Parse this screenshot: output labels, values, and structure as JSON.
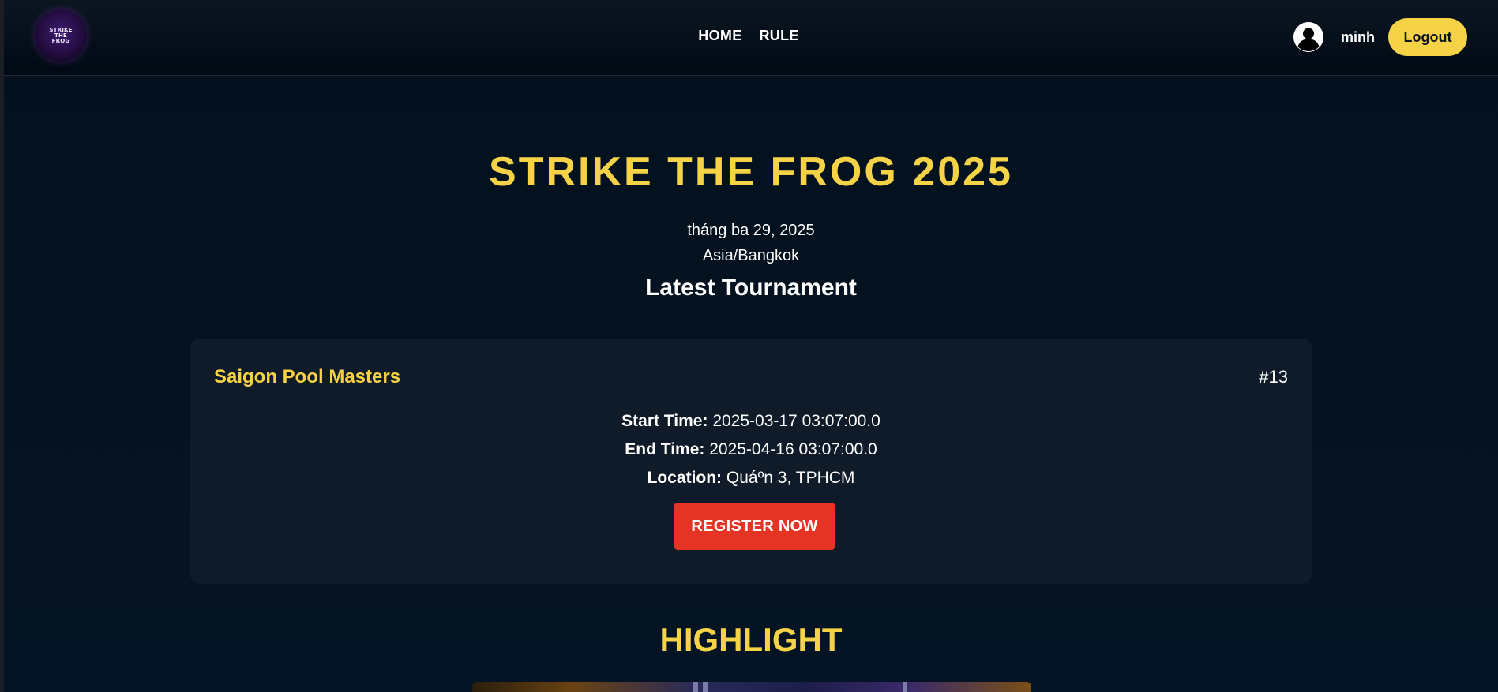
{
  "header": {
    "logo_text": "STRIKE\nTHE\nFROG",
    "nav": [
      {
        "label": "HOME"
      },
      {
        "label": "RULE"
      }
    ],
    "username": "minh",
    "logout_label": "Logout"
  },
  "hero": {
    "title": "STRIKE THE FROG 2025",
    "date": "tháng ba 29, 2025",
    "timezone": "Asia/Bangkok",
    "section_title": "Latest Tournament"
  },
  "tournament": {
    "name": "Saigon Pool Masters",
    "id": "#13",
    "start_label": "Start Time:",
    "start_value": "2025-03-17 03:07:00.0",
    "end_label": "End Time:",
    "end_value": "2025-04-16 03:07:00.0",
    "location_label": "Location:",
    "location_value": "Quáº­n 3, TPHCM",
    "register_label": "REGISTER NOW"
  },
  "highlight": {
    "title": "HIGHLIGHT"
  },
  "colors": {
    "accent_yellow": "#f6d247",
    "register_red": "#e53423",
    "background": "#04111f",
    "card": "#0f1b28"
  }
}
